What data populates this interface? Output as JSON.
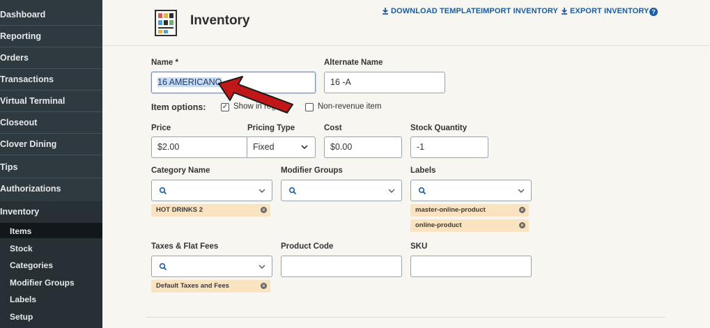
{
  "sidebar": {
    "items": [
      {
        "label": "Dashboard"
      },
      {
        "label": "Reporting"
      },
      {
        "label": "Orders"
      },
      {
        "label": "Transactions"
      },
      {
        "label": "Virtual Terminal"
      },
      {
        "label": "Closeout"
      },
      {
        "label": "Clover Dining"
      },
      {
        "label": "Tips"
      },
      {
        "label": "Authorizations"
      },
      {
        "label": "Inventory"
      }
    ],
    "subitems": [
      {
        "label": "Items"
      },
      {
        "label": "Stock"
      },
      {
        "label": "Categories"
      },
      {
        "label": "Modifier Groups"
      },
      {
        "label": "Labels"
      },
      {
        "label": "Setup"
      }
    ]
  },
  "header": {
    "title": "Inventory",
    "download_template": "DOWNLOAD TEMPLATE",
    "import_inventory": "IMPORT INVENTORY",
    "export_inventory": "EXPORT INVENTORY",
    "help": "?"
  },
  "form": {
    "name_label": "Name *",
    "name_value": "16 AMERICANO",
    "alt_name_label": "Alternate Name",
    "alt_name_value": "16 -A",
    "item_options_label": "Item options:",
    "show_register_label": "Show in register",
    "show_register_checked": true,
    "non_revenue_label": "Non-revenue item",
    "non_revenue_checked": false,
    "price_label": "Price",
    "price_value": "$2.00",
    "pricing_type_label": "Pricing Type",
    "pricing_type_value": "Fixed",
    "cost_label": "Cost",
    "cost_value": "$0.00",
    "stock_label": "Stock Quantity",
    "stock_value": "-1",
    "category_label": "Category Name",
    "category_chips": [
      "HOT DRINKS 2"
    ],
    "modifier_label": "Modifier Groups",
    "labels_label": "Labels",
    "labels_chips": [
      "master-online-product",
      "online-product"
    ],
    "taxes_label": "Taxes & Flat Fees",
    "taxes_chips": [
      "Default Taxes and Fees"
    ],
    "product_code_label": "Product Code",
    "sku_label": "SKU"
  },
  "colors": {
    "sidebar_bg": "#2f3a40",
    "link_blue": "#1a5aa8",
    "chip_bg": "#fae3c0",
    "arrow_red": "#c01818"
  }
}
